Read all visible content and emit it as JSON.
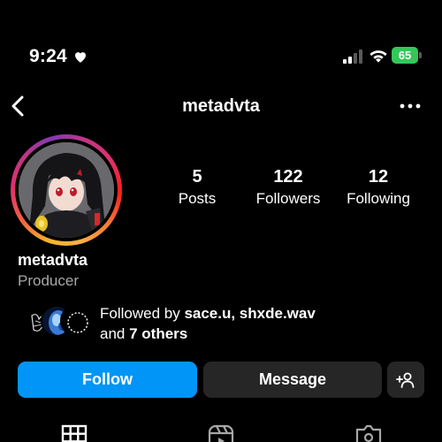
{
  "status_bar": {
    "time": "9:24",
    "battery": "65",
    "battery_color": "#33c759"
  },
  "header": {
    "username": "metadvta",
    "back_icon": "chevron-left-icon",
    "more_icon": "more-horizontal-icon"
  },
  "profile": {
    "name": "metadvta",
    "category": "Producer",
    "stats": [
      {
        "value": "5",
        "label": "Posts"
      },
      {
        "value": "122",
        "label": "Followers"
      },
      {
        "value": "12",
        "label": "Following"
      }
    ]
  },
  "followed_by": {
    "prefix": "Followed by ",
    "users": "sace.u, shxde.wav",
    "and": "and ",
    "others": "7 others"
  },
  "actions": {
    "follow": "Follow",
    "message": "Message",
    "follow_color": "#0095f6",
    "secondary_color": "#262626"
  },
  "tabs": [
    "grid-icon",
    "reels-icon",
    "tagged-icon"
  ]
}
